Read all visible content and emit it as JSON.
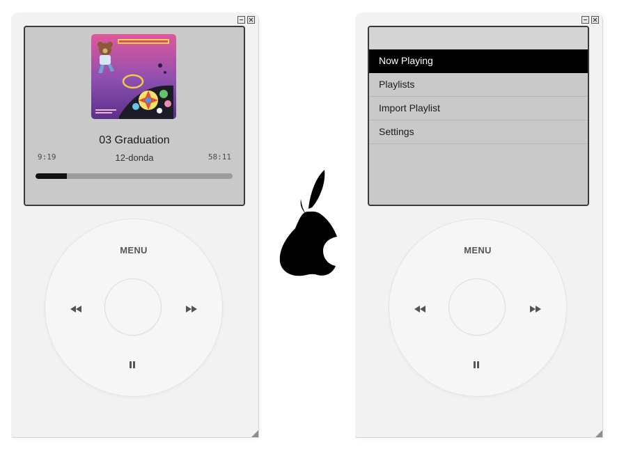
{
  "left_player": {
    "window_controls": [
      "minimize",
      "close"
    ],
    "screen": {
      "album_art_icon": "album-art-graduation",
      "track_title": "03 Graduation",
      "album": "12-donda",
      "time_elapsed": "9:19",
      "time_total": "58:11",
      "progress_fraction": 0.16
    },
    "wheel": {
      "menu_label": "MENU",
      "prev_icon": "rewind-icon",
      "next_icon": "fast-forward-icon",
      "play_icon": "pause-icon"
    }
  },
  "right_player": {
    "window_controls": [
      "minimize",
      "close"
    ],
    "screen": {
      "menu_items": [
        {
          "label": "Now Playing",
          "selected": true
        },
        {
          "label": "Playlists",
          "selected": false
        },
        {
          "label": "Import Playlist",
          "selected": false
        },
        {
          "label": "Settings",
          "selected": false
        }
      ]
    },
    "wheel": {
      "menu_label": "MENU",
      "prev_icon": "rewind-icon",
      "next_icon": "fast-forward-icon",
      "play_icon": "pause-icon"
    }
  },
  "logo_icon": "pear-logo-icon",
  "colors": {
    "screen_bg": "#c9c9c9",
    "selection": "#000000",
    "body": "#f2f2f2",
    "progress_fill": "#111111",
    "progress_track": "#9c9c9c"
  }
}
